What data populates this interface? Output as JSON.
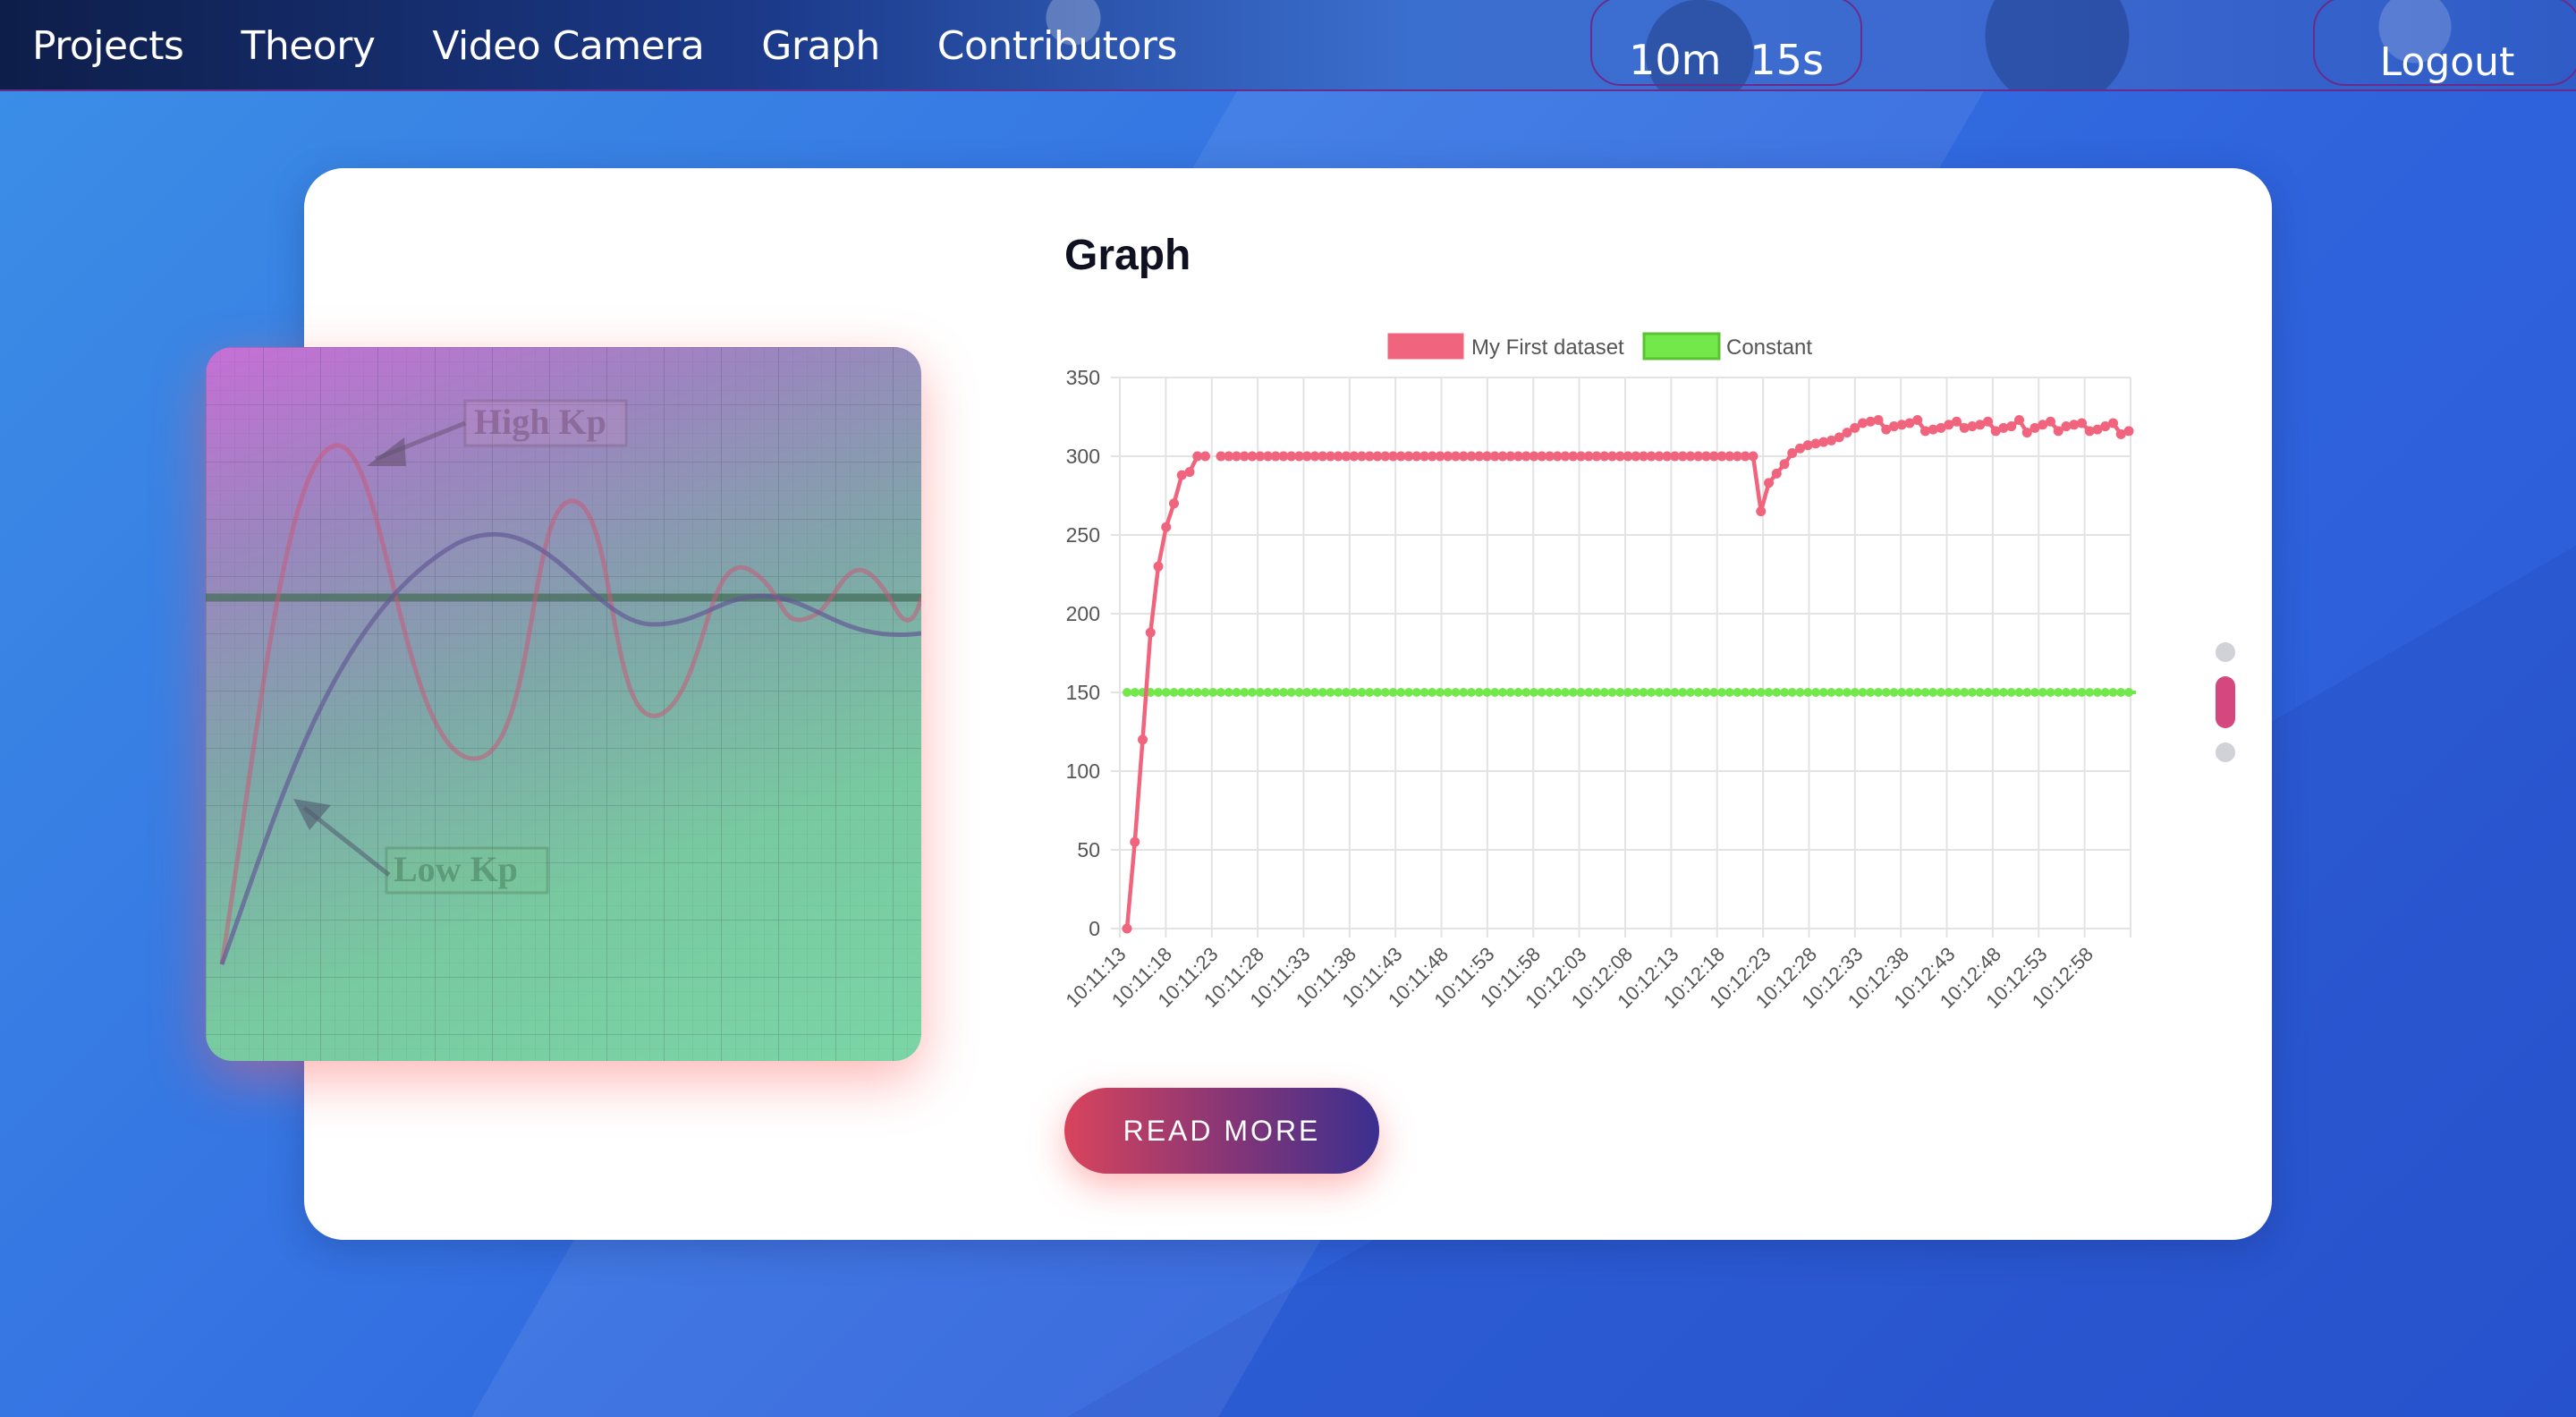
{
  "nav": {
    "links": [
      "Projects",
      "Theory",
      "Video Camera",
      "Graph",
      "Contributors"
    ],
    "timer": {
      "minutes": "10m",
      "seconds": "15s"
    },
    "logout": "Logout"
  },
  "image_panel": {
    "labels": {
      "high": "High Kp",
      "low": "Low Kp"
    }
  },
  "section": {
    "title": "Graph",
    "button": "READ MORE"
  },
  "pager": {
    "count": 3,
    "active": 1
  },
  "colors": {
    "dataset": "#f0647d",
    "constant": "#73e84b",
    "accent": "#d4477f"
  },
  "chart_data": {
    "type": "line",
    "ylim": [
      0,
      350
    ],
    "yticks": [
      0,
      50,
      100,
      150,
      200,
      250,
      300,
      350
    ],
    "xtick_labels": [
      "10:11:13",
      "10:11:18",
      "10:11:23",
      "10:11:28",
      "10:11:33",
      "10:11:38",
      "10:11:43",
      "10:11:48",
      "10:11:53",
      "10:11:58",
      "10:12:03",
      "10:12:08",
      "10:12:13",
      "10:12:18",
      "10:12:23",
      "10:12:28",
      "10:12:33",
      "10:12:38",
      "10:12:43",
      "10:12:48",
      "10:12:53",
      "10:12:58"
    ],
    "x_start": "10:11:13",
    "x_end": "10:13:02",
    "series": [
      {
        "name": "My First dataset",
        "color": "#f0647d",
        "values": [
          0,
          55,
          120,
          188,
          230,
          255,
          270,
          288,
          290,
          300,
          300,
          null,
          300,
          300,
          300,
          300,
          300,
          300,
          300,
          300,
          300,
          300,
          300,
          300,
          300,
          300,
          300,
          300,
          300,
          300,
          300,
          300,
          300,
          300,
          300,
          300,
          300,
          300,
          300,
          300,
          300,
          300,
          300,
          300,
          300,
          300,
          300,
          300,
          300,
          300,
          300,
          300,
          300,
          300,
          300,
          300,
          300,
          300,
          300,
          300,
          300,
          300,
          300,
          300,
          300,
          300,
          300,
          300,
          300,
          300,
          300,
          300,
          300,
          300,
          300,
          300,
          300,
          300,
          300,
          300,
          300,
          265,
          283,
          289,
          295,
          302,
          305,
          307,
          308,
          309,
          310,
          312,
          315,
          318,
          321,
          322,
          323,
          317,
          319,
          320,
          321,
          323,
          316,
          317,
          318,
          320,
          322,
          318,
          319,
          320,
          322,
          316,
          318,
          319,
          323,
          315,
          318,
          320,
          322,
          316,
          319,
          320,
          321,
          316,
          317,
          319,
          321,
          314,
          316
        ],
        "values_note": ""
      },
      {
        "name": "Constant",
        "color": "#73e84b",
        "value": 150
      }
    ]
  }
}
